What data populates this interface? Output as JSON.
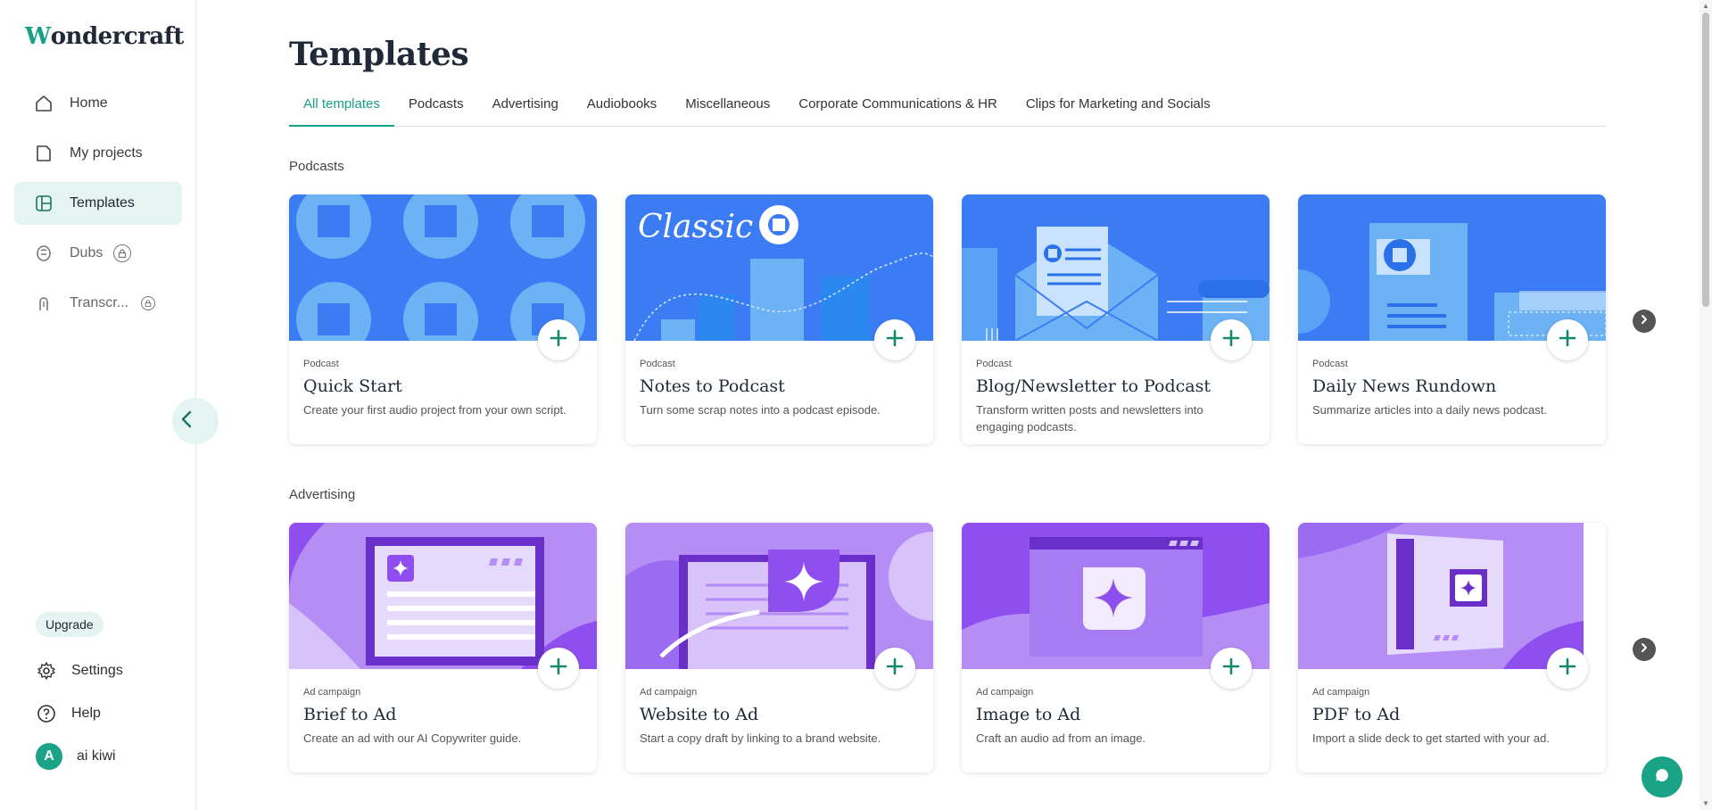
{
  "app": {
    "logo_mark": "W",
    "logo_text": "ondercraft"
  },
  "sidebar": {
    "items": [
      {
        "label": "Home",
        "icon": "home-icon"
      },
      {
        "label": "My projects",
        "icon": "folder-icon"
      },
      {
        "label": "Templates",
        "icon": "templates-icon"
      },
      {
        "label": "Dubs",
        "icon": "dubs-icon"
      },
      {
        "label": "Transcr...",
        "icon": "transcribe-icon"
      }
    ],
    "upgrade_label": "Upgrade",
    "settings_label": "Settings",
    "help_label": "Help",
    "user_initial": "A",
    "user_name": "ai kiwi"
  },
  "main": {
    "title": "Templates",
    "tabs": [
      "All templates",
      "Podcasts",
      "Advertising",
      "Audiobooks",
      "Miscellaneous",
      "Corporate Communications & HR",
      "Clips for Marketing and Socials"
    ],
    "active_tab": "All templates",
    "sections": [
      {
        "label": "Podcasts",
        "cards": [
          {
            "category": "Podcast",
            "title": "Quick Start",
            "description": "Create your first audio project from your own script."
          },
          {
            "category": "Podcast",
            "title": "Notes to Podcast",
            "description": "Turn some scrap notes into a podcast episode.",
            "thumb_text": "Classic"
          },
          {
            "category": "Podcast",
            "title": "Blog/Newsletter to Podcast",
            "description": "Transform written posts and newsletters into engaging podcasts."
          },
          {
            "category": "Podcast",
            "title": "Daily News Rundown",
            "description": "Summarize articles into a daily news podcast."
          }
        ]
      },
      {
        "label": "Advertising",
        "cards": [
          {
            "category": "Ad campaign",
            "title": "Brief to Ad",
            "description": "Create an ad with our AI Copywriter guide."
          },
          {
            "category": "Ad campaign",
            "title": "Website to Ad",
            "description": "Start a copy draft by linking to a brand website."
          },
          {
            "category": "Ad campaign",
            "title": "Image to Ad",
            "description": "Craft an audio ad from an image."
          },
          {
            "category": "Ad campaign",
            "title": "PDF to Ad",
            "description": "Import a slide deck to get started with your ad."
          }
        ]
      }
    ]
  },
  "colors": {
    "accent": "#16a085",
    "accent_light": "#e3f4f1",
    "podcast_blue": "#3b7cf5",
    "ad_purple": "#9b5cf0"
  }
}
